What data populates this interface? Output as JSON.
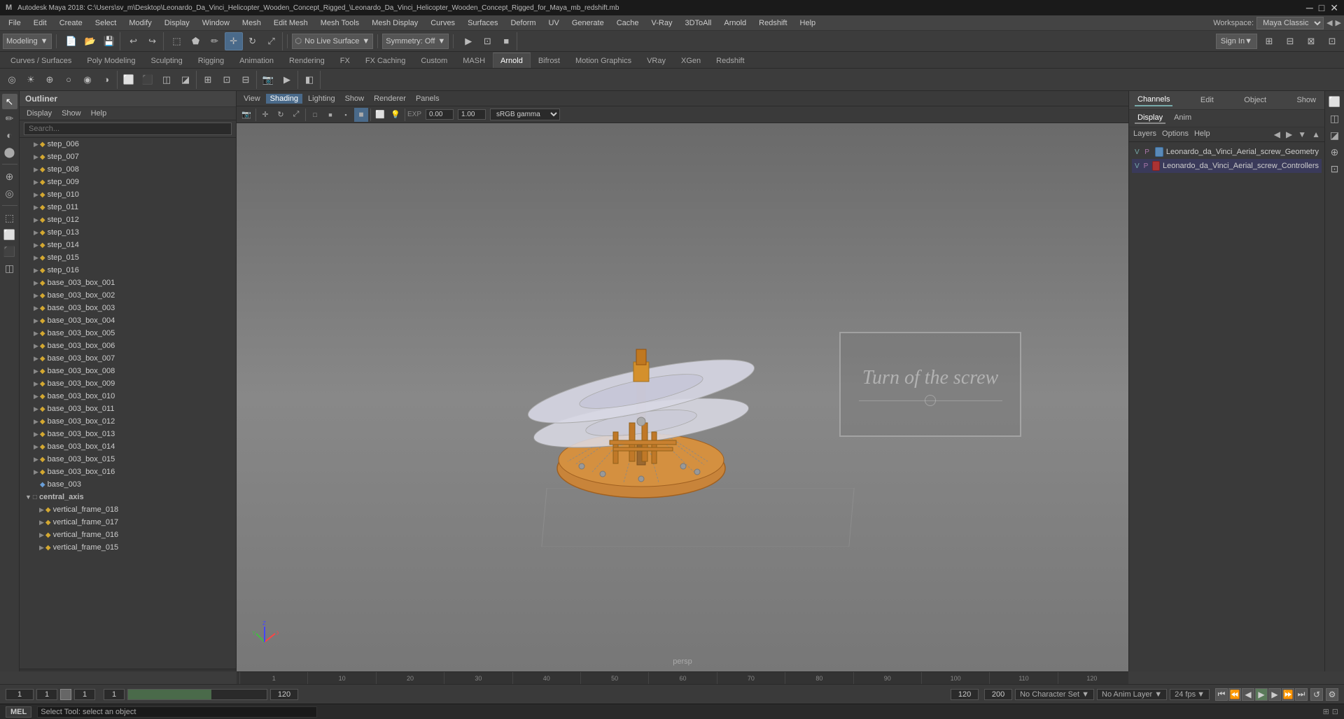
{
  "title": "Autodesk Maya 2018: C:\\Users\\sv_m\\Desktop\\Leonardo_Da_Vinci_Helicopter_Wooden_Concept_Rigged_\\Leonardo_Da_Vinci_Helicopter_Wooden_Concept_Rigged_for_Maya_mb_redshift.mb",
  "workspace": {
    "label": "Workspace:",
    "value": "Maya Classic"
  },
  "menu": {
    "items": [
      "File",
      "Edit",
      "Create",
      "Select",
      "Modify",
      "Display",
      "Window",
      "Mesh",
      "Edit Mesh",
      "Mesh Tools",
      "Mesh Display",
      "Curves",
      "Surfaces",
      "Deform",
      "UV",
      "Generate",
      "Cache",
      "V-Ray",
      "3DToAll",
      "Arnold",
      "Redshift",
      "Help"
    ]
  },
  "toolbar": {
    "mode": "Modeling",
    "live_surface": "No Live Surface",
    "symmetry": "Symmetry: Off",
    "sign_in": "Sign In"
  },
  "tabs": {
    "items": [
      "Curves / Surfaces",
      "Poly Modeling",
      "Sculpting",
      "Rigging",
      "Animation",
      "Rendering",
      "FX",
      "FX Caching",
      "Custom",
      "MASH",
      "Arnold",
      "Bifrost",
      "Motion Graphics",
      "VRay",
      "XGen",
      "Redshift"
    ]
  },
  "outliner": {
    "title": "Outliner",
    "menu": [
      "Display",
      "Show",
      "Help"
    ],
    "search_placeholder": "Search...",
    "items": [
      {
        "name": "step_006",
        "type": "mesh",
        "indent": 1
      },
      {
        "name": "step_007",
        "type": "mesh",
        "indent": 1
      },
      {
        "name": "step_008",
        "type": "mesh",
        "indent": 1
      },
      {
        "name": "step_009",
        "type": "mesh",
        "indent": 1
      },
      {
        "name": "step_010",
        "type": "mesh",
        "indent": 1
      },
      {
        "name": "step_011",
        "type": "mesh",
        "indent": 1
      },
      {
        "name": "step_012",
        "type": "mesh",
        "indent": 1
      },
      {
        "name": "step_013",
        "type": "mesh",
        "indent": 1
      },
      {
        "name": "step_014",
        "type": "mesh",
        "indent": 1
      },
      {
        "name": "step_015",
        "type": "mesh",
        "indent": 1
      },
      {
        "name": "step_016",
        "type": "mesh",
        "indent": 1
      },
      {
        "name": "base_003_box_001",
        "type": "mesh",
        "indent": 1
      },
      {
        "name": "base_003_box_002",
        "type": "mesh",
        "indent": 1
      },
      {
        "name": "base_003_box_003",
        "type": "mesh",
        "indent": 1
      },
      {
        "name": "base_003_box_004",
        "type": "mesh",
        "indent": 1
      },
      {
        "name": "base_003_box_005",
        "type": "mesh",
        "indent": 1
      },
      {
        "name": "base_003_box_006",
        "type": "mesh",
        "indent": 1
      },
      {
        "name": "base_003_box_007",
        "type": "mesh",
        "indent": 1
      },
      {
        "name": "base_003_box_008",
        "type": "mesh",
        "indent": 1
      },
      {
        "name": "base_003_box_009",
        "type": "mesh",
        "indent": 1
      },
      {
        "name": "base_003_box_010",
        "type": "mesh",
        "indent": 1
      },
      {
        "name": "base_003_box_011",
        "type": "mesh",
        "indent": 1
      },
      {
        "name": "base_003_box_012",
        "type": "mesh",
        "indent": 1
      },
      {
        "name": "base_003_box_013",
        "type": "mesh",
        "indent": 1
      },
      {
        "name": "base_003_box_014",
        "type": "mesh",
        "indent": 1
      },
      {
        "name": "base_003_box_015",
        "type": "mesh",
        "indent": 1
      },
      {
        "name": "base_003_box_016",
        "type": "mesh",
        "indent": 1
      },
      {
        "name": "base_003",
        "type": "group",
        "indent": 1
      },
      {
        "name": "central_axis",
        "type": "group",
        "indent": 0,
        "expanded": true
      },
      {
        "name": "vertical_frame_018",
        "type": "mesh",
        "indent": 2
      },
      {
        "name": "vertical_frame_017",
        "type": "mesh",
        "indent": 2
      },
      {
        "name": "vertical_frame_016",
        "type": "mesh",
        "indent": 2
      },
      {
        "name": "vertical_frame_015",
        "type": "mesh",
        "indent": 2
      }
    ]
  },
  "viewport": {
    "menus": [
      "View",
      "Shading",
      "Lighting",
      "Show",
      "Renderer",
      "Panels"
    ],
    "label": "persp",
    "gamma": "sRGB gamma",
    "exposure": "0.00",
    "gamma_value": "1.00"
  },
  "text_box": {
    "title": "Turn of the screw"
  },
  "channel_box": {
    "tabs": [
      "Channels",
      "Edit",
      "Object",
      "Show"
    ],
    "display_tabs": [
      "Display",
      "Anim"
    ],
    "sub_tabs": [
      "Layers",
      "Options",
      "Help"
    ],
    "items": [
      {
        "v": "V",
        "p": "P",
        "color": "#6a9fd8",
        "label": "Leonardo_da_Vinci_Aerial_screw_Geometry"
      },
      {
        "v": "V",
        "p": "P",
        "color": "#cc4444",
        "label": "Leonardo_da_Vinci_Aerial_screw_Controllers"
      }
    ]
  },
  "timeline": {
    "start": "1",
    "end": "120",
    "current": "1",
    "range_start": "1",
    "range_end": "120",
    "max_end": "200",
    "fps": "24 fps",
    "marks": [
      "1",
      "10",
      "20",
      "30",
      "40",
      "50",
      "60",
      "70",
      "80",
      "90",
      "100",
      "110",
      "120"
    ]
  },
  "bottom_controls": {
    "frame_field": "1",
    "range_start": "1",
    "range_end_color": "green",
    "char_set": "No Character Set",
    "anim_layer": "No Anim Layer"
  },
  "status_bar": {
    "mode": "MEL",
    "message": "Select Tool: select an object"
  },
  "icons": {
    "arrow": "▶",
    "chevron_right": "▶",
    "chevron_down": "▼",
    "diamond": "◆",
    "square": "■",
    "circle": "●",
    "triangle": "▲"
  }
}
